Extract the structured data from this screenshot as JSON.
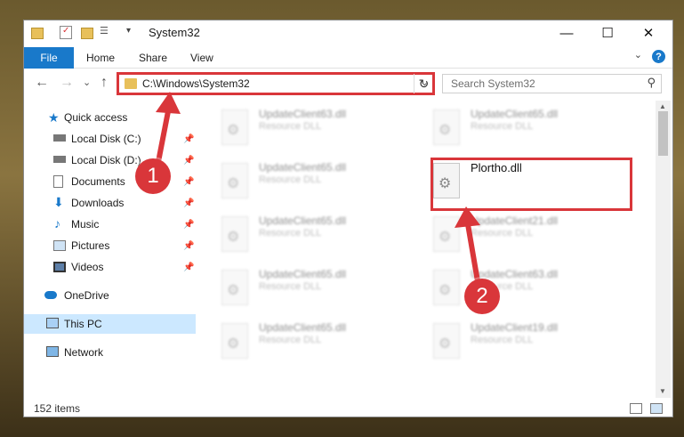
{
  "window": {
    "title": "System32",
    "controls": {
      "minimize": "—",
      "maximize": "☐",
      "close": "✕"
    }
  },
  "ribbon": {
    "tabs": [
      "File",
      "Home",
      "Share",
      "View"
    ],
    "help_label": "?",
    "expand_label": "⌄"
  },
  "navigation": {
    "back_icon": "←",
    "forward_icon": "→",
    "recent_icon": "⌄",
    "up_icon": "↑",
    "address_path": "C:\\Windows\\System32",
    "address_dropdown": "⌄",
    "refresh_icon": "↻",
    "search_placeholder": "Search System32",
    "search_icon": "⚲"
  },
  "sidebar": {
    "items": [
      {
        "label": "Quick access",
        "icon": "star-icon",
        "pinned": false
      },
      {
        "label": "Local Disk (C:)",
        "icon": "drive-icon",
        "pinned": true
      },
      {
        "label": "Local Disk (D:)",
        "icon": "drive-icon",
        "pinned": true
      },
      {
        "label": "Documents",
        "icon": "documents-icon",
        "pinned": true
      },
      {
        "label": "Downloads",
        "icon": "download-icon",
        "pinned": true
      },
      {
        "label": "Music",
        "icon": "music-icon",
        "pinned": true
      },
      {
        "label": "Pictures",
        "icon": "pictures-icon",
        "pinned": true
      },
      {
        "label": "Videos",
        "icon": "videos-icon",
        "pinned": true
      },
      {
        "label": "OneDrive",
        "icon": "cloud-icon",
        "pinned": false
      },
      {
        "label": "This PC",
        "icon": "computer-icon",
        "pinned": false,
        "selected": true
      },
      {
        "label": "Network",
        "icon": "network-icon",
        "pinned": false
      }
    ],
    "pin_glyph": "📌"
  },
  "files": {
    "left_column": [
      {
        "name": "UpdateClient63.dll",
        "type": "Resource DLL"
      },
      {
        "name": "UpdateClient65.dll",
        "type": "Resource DLL"
      },
      {
        "name": "UpdateClient65.dll",
        "type": "Resource DLL"
      },
      {
        "name": "UpdateClient65.dll",
        "type": "Resource DLL"
      },
      {
        "name": "UpdateClient65.dll",
        "type": "Resource DLL"
      }
    ],
    "right_column": [
      {
        "name": "UpdateClient65.dll",
        "type": "Resource DLL"
      },
      {
        "name": "Plortho.dll",
        "type": ""
      },
      {
        "name": "UpdateClient21.dll",
        "type": "Resource DLL"
      },
      {
        "name": "UpdateClient63.dll",
        "type": "Resource DLL"
      },
      {
        "name": "UpdateClient19.dll",
        "type": "Resource DLL"
      }
    ]
  },
  "annotations": {
    "step1": "1",
    "step2": "2",
    "highlight_color": "#d9363a"
  },
  "status": {
    "item_count": "152 items"
  }
}
